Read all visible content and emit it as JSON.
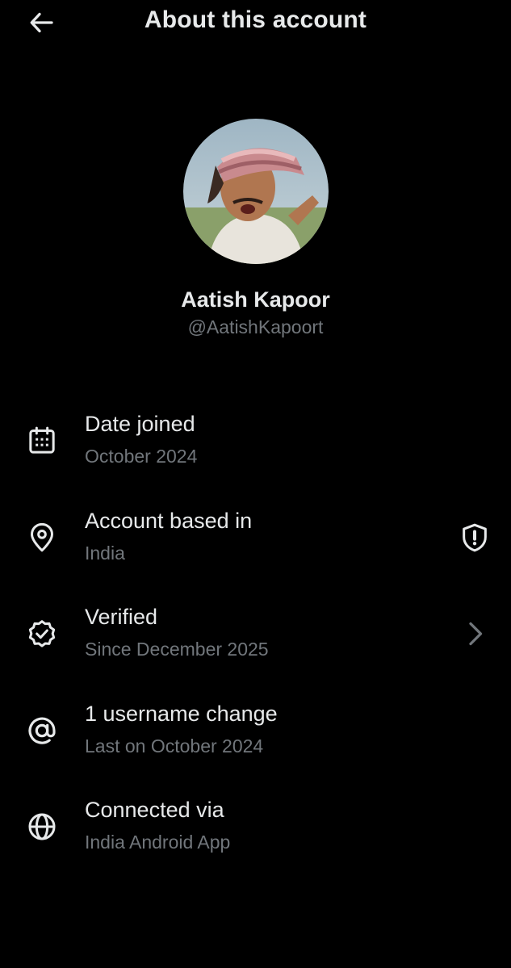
{
  "header": {
    "title": "About this account",
    "back_icon": "arrow-left-icon"
  },
  "profile": {
    "name": "Aatish Kapoor",
    "handle": "@AatishKapoort"
  },
  "rows": [
    {
      "icon": "calendar-icon",
      "title": "Date joined",
      "subtitle": "October 2024"
    },
    {
      "icon": "location-pin-icon",
      "title": "Account based in",
      "subtitle": "India",
      "trailing": "shield-alert-icon"
    },
    {
      "icon": "verified-badge-icon",
      "title": "Verified",
      "subtitle": "Since December 2025",
      "trailing": "chevron-right-icon"
    },
    {
      "icon": "at-sign-icon",
      "title": "1 username change",
      "subtitle": "Last on October 2024"
    },
    {
      "icon": "globe-icon",
      "title": "Connected via",
      "subtitle": "India Android App"
    }
  ],
  "colors": {
    "background": "#000000",
    "primary_text": "#e7e9ea",
    "secondary_text": "#71767b"
  }
}
